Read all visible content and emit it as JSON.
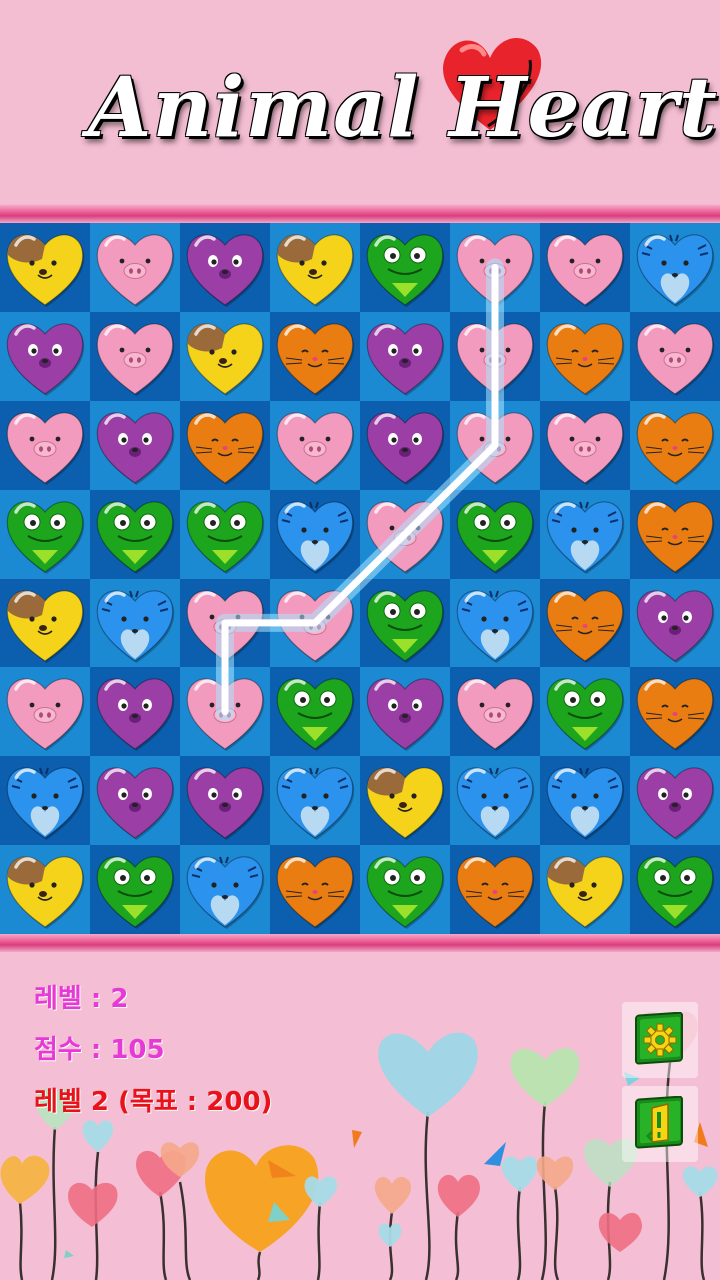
{
  "title": "Animal Heart",
  "colors": {
    "background": "#f4bfd4",
    "board_dark": "#0b5fae",
    "board_light": "#1c8ad3",
    "stat_text": "#e63ad6",
    "goal_text": "#e8121b",
    "link_glow": "#ffffff"
  },
  "stats": {
    "level": "레벨 : 2",
    "score": "점수 : 105",
    "goal": "레벨 2 (목표 : 200)"
  },
  "board": {
    "rows": [
      [
        "dog",
        "pig",
        "bear",
        "dog",
        "frog",
        "pig",
        "pig",
        "tiger"
      ],
      [
        "bear",
        "pig",
        "dog",
        "cat",
        "bear",
        "pig",
        "cat",
        "pig"
      ],
      [
        "pig",
        "bear",
        "cat",
        "pig",
        "bear",
        "pig",
        "pig",
        "cat"
      ],
      [
        "frog",
        "frog",
        "frog",
        "tiger",
        "pig",
        "frog",
        "tiger",
        "cat"
      ],
      [
        "dog",
        "tiger",
        "pig",
        "pig",
        "frog",
        "tiger",
        "cat",
        "bear"
      ],
      [
        "pig",
        "bear",
        "pig",
        "frog",
        "bear",
        "pig",
        "frog",
        "cat"
      ],
      [
        "tiger",
        "bear",
        "bear",
        "tiger",
        "dog",
        "tiger",
        "tiger",
        "bear"
      ],
      [
        "dog",
        "frog",
        "tiger",
        "cat",
        "frog",
        "cat",
        "dog",
        "frog"
      ]
    ],
    "piece_colors": {
      "dog": "#f5d31a",
      "pig": "#f29bbf",
      "bear": "#9b3fa6",
      "frog": "#1da51d",
      "tiger": "#2b92ee",
      "cat": "#ea7d12"
    },
    "link_path": [
      [
        0,
        5
      ],
      [
        1,
        5
      ],
      [
        2,
        5
      ],
      [
        4,
        3
      ],
      [
        4,
        2
      ],
      [
        5,
        2
      ]
    ]
  },
  "buttons": {
    "settings": "gear-icon",
    "exit": "exit-door-icon"
  }
}
